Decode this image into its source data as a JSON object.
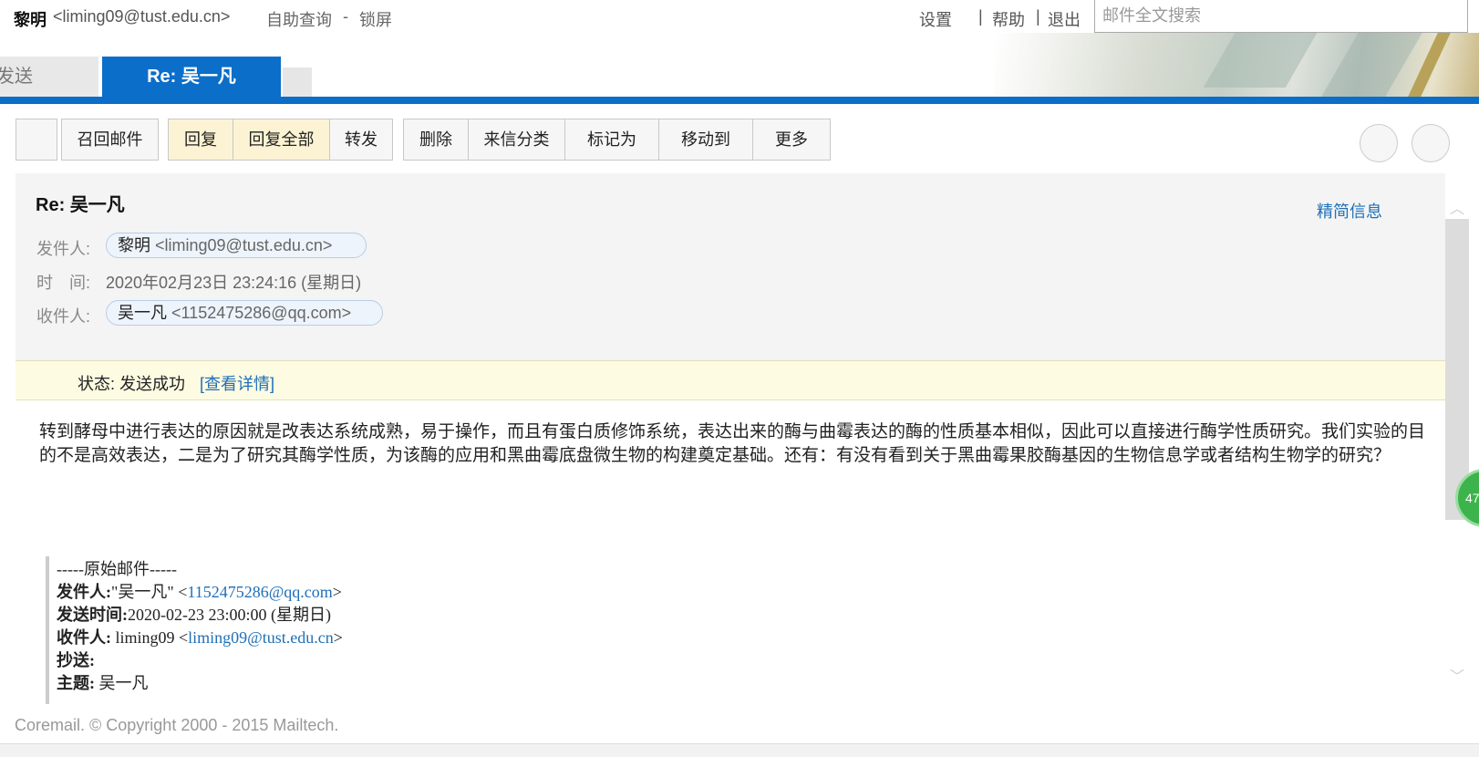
{
  "topbar": {
    "user_name": "黎明",
    "user_email": "<liming09@tust.edu.cn>",
    "self_query": "自助查询",
    "dash": "-",
    "lock": "锁屏",
    "settings": "设置",
    "sep": "|",
    "help": "帮助",
    "logout": "退出",
    "search_placeholder": "邮件全文搜索"
  },
  "tabs": {
    "send": "发送",
    "active": "Re: 吴一凡"
  },
  "toolbar": {
    "recall": "召回邮件",
    "reply": "回复",
    "reply_all": "回复全部",
    "forward": "转发",
    "delete": "删除",
    "classify": "来信分类",
    "mark_as": "标记为",
    "move_to": "移动到",
    "more": "更多"
  },
  "header": {
    "subject": "Re: 吴一凡",
    "brief_info": "精简信息",
    "from_label": "发件人:",
    "from_name": "黎明",
    "from_email": "<liming09@tust.edu.cn>",
    "time_label": "时　间:",
    "time_value": "2020年02月23日 23:24:16 (星期日)",
    "to_label": "收件人:",
    "to_name": "吴一凡",
    "to_email": "<1152475286@qq.com>"
  },
  "status": {
    "label": "状态: 发送成功",
    "link": "[查看详情]"
  },
  "body": {
    "text": "转到酵母中进行表达的原因就是改表达系统成熟，易于操作，而且有蛋白质修饰系统，表达出来的酶与曲霉表达的酶的性质基本相似，因此可以直接进行酶学性质研究。我们实验的目的不是高效表达，二是为了研究其酶学性质，为该酶的应用和黑曲霉底盘微生物的构建奠定基础。还有：有没有看到关于黑曲霉果胶酶基因的生物信息学或者结构生物学的研究？"
  },
  "original": {
    "divider": "-----原始邮件-----",
    "from_label": "发件人:",
    "from_name": "\"吴一凡\" <",
    "from_email": "1152475286@qq.com",
    "from_end": ">",
    "sent_label": "发送时间:",
    "sent_value": "2020-02-23 23:00:00 (星期日)",
    "to_label": "收件人:",
    "to_name": " liming09 <",
    "to_email": "liming09@tust.edu.cn",
    "to_end": ">",
    "cc_label": "抄送:",
    "subject_label": "主题:",
    "subject_value": " 吴一凡"
  },
  "badge": {
    "value": "47"
  },
  "footer": {
    "text": "Coremail. © Copyright 2000 - 2015 Mailtech."
  },
  "scroll": {
    "up_icon": "chevron-up-icon",
    "down_icon": "chevron-down-icon"
  }
}
